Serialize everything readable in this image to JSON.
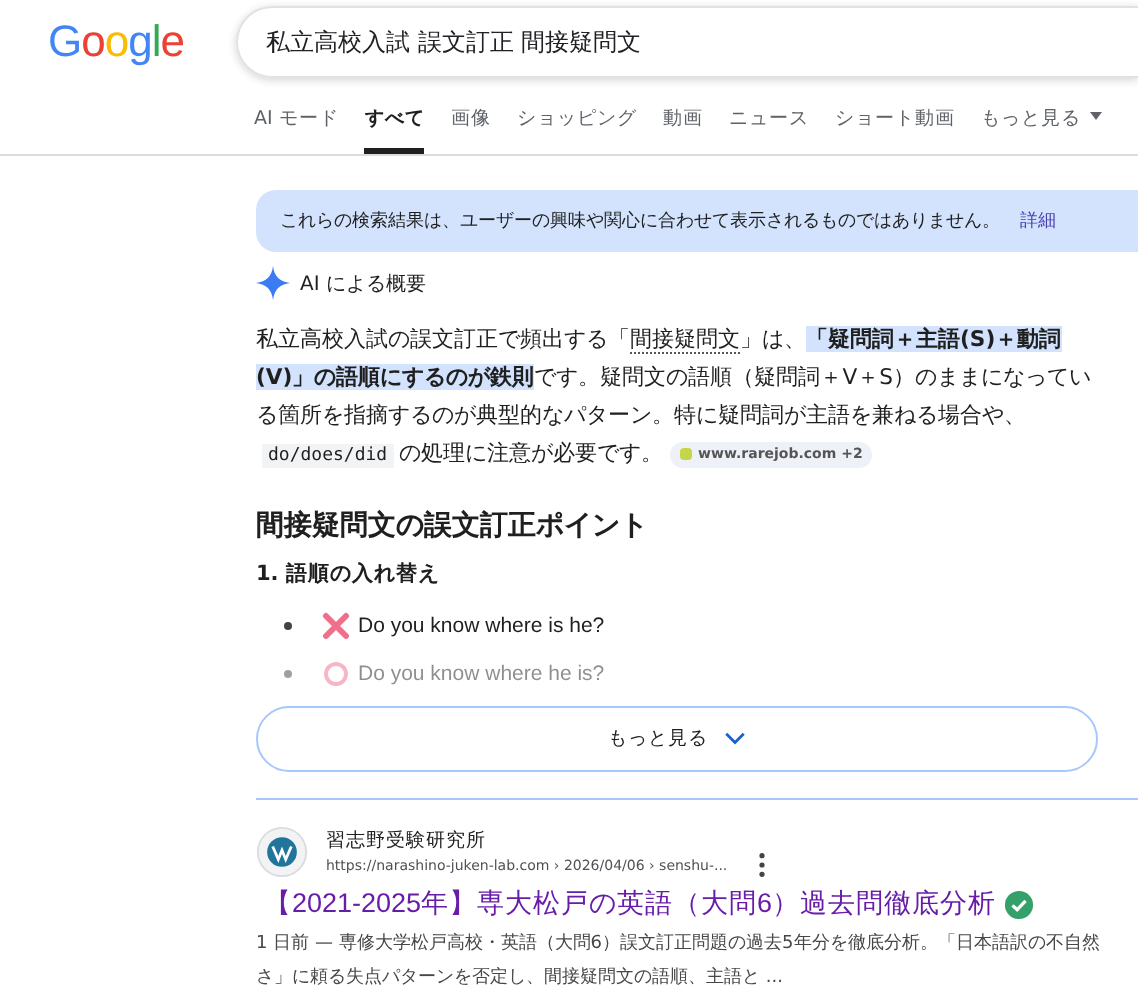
{
  "logo": "Google",
  "search": {
    "value": "私立高校入試 誤文訂正 間接疑問文"
  },
  "tabs": [
    {
      "label": "AI モード",
      "selected": false
    },
    {
      "label": "すべて",
      "selected": true
    },
    {
      "label": "画像",
      "selected": false
    },
    {
      "label": "ショッピング",
      "selected": false
    },
    {
      "label": "動画",
      "selected": false
    },
    {
      "label": "ニュース",
      "selected": false
    },
    {
      "label": "ショート動画",
      "selected": false
    },
    {
      "label": "もっと見る",
      "selected": false,
      "kind": "more"
    }
  ],
  "notice": {
    "text": "これらの検索結果は、ユーザーの興味や関心に合わせて表示されるものではありません。",
    "link": "詳細"
  },
  "ai_overview": {
    "label": "AI による概要",
    "paragraph": [
      {
        "kind": "plain",
        "text": "私立高校入試の誤文訂正で頻出する「"
      },
      {
        "kind": "underline",
        "text": "間接疑問文"
      },
      {
        "kind": "plain",
        "text": "」は、"
      },
      {
        "kind": "bold",
        "text": "「疑問詞＋主語(S)＋動詞(V)」の語順にするのが鉄則"
      },
      {
        "kind": "plain",
        "text": "です。疑問文の語順（疑問詞＋V＋S）のままになっている箇所を指摘するのが典型的なパターン。特に疑問詞が主語を兼ねる場合や、"
      },
      {
        "kind": "code",
        "text": "do/does/did"
      },
      {
        "kind": "plain",
        "text": "の処理に注意が必要です。"
      }
    ],
    "source_chip": "www.rarejob.com +2",
    "heading": "間接疑問文の誤文訂正ポイント",
    "subheading": "1. 語順の入れ替え",
    "bullets": [
      {
        "kind": "wrong",
        "text": "Do you know where is he?"
      },
      {
        "kind": "right",
        "text": "Do you know where he is?"
      }
    ],
    "more_button": "もっと見る"
  },
  "result": {
    "site": "習志野受験研究所",
    "url": "https://narashino-juken-lab.com › 2026/04/06 › senshu-...",
    "title": "【2021-2025年】専大松戸の英語（大問6）過去問徹底分析",
    "verified": true,
    "snippet": "1 日前 — 専修大学松戸高校・英語（大問6）誤文訂正問題の過去5年分を徹底分析。「日本語訳の不自然さ」に頼る失点パターンを否定し、間接疑問文の語順、主語と ..."
  }
}
